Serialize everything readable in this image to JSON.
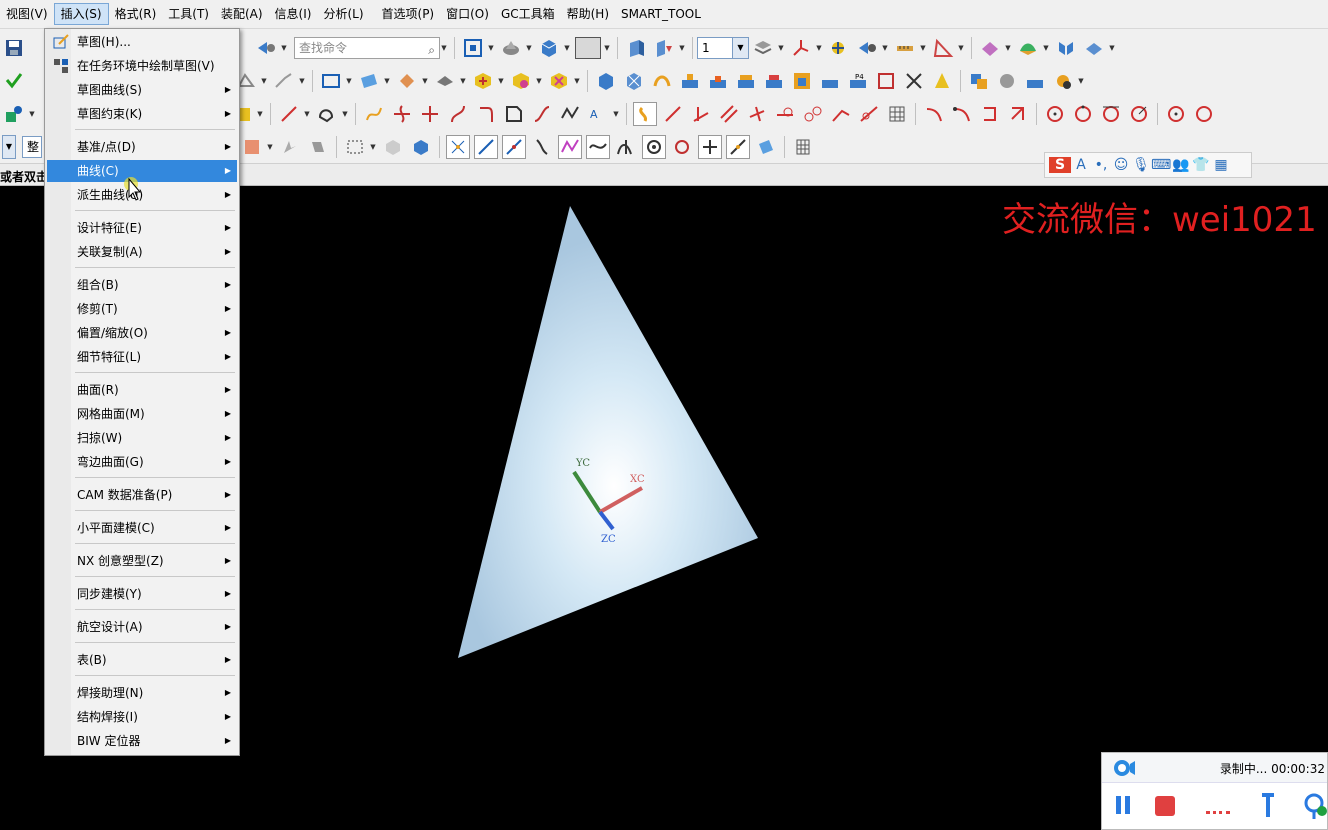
{
  "menubar": [
    "视图(V)",
    "插入(S)",
    "格式(R)",
    "工具(T)",
    "装配(A)",
    "信息(I)",
    "分析(L)",
    "首选项(P)",
    "窗口(O)",
    "GC工具箱",
    "帮助(H)",
    "SMART_TOOL"
  ],
  "toolbar": {
    "search_placeholder": "查找命令",
    "layer_value": "1",
    "filter_value": "整"
  },
  "status": {
    "prompt": "或者双击"
  },
  "menu": {
    "items": [
      {
        "label": "草图(H)...",
        "sub": false,
        "icon": "sketch-icon"
      },
      {
        "label": "在任务环境中绘制草图(V)",
        "sub": false,
        "icon": "sketch-task-icon"
      },
      {
        "label": "草图曲线(S)",
        "sub": true
      },
      {
        "label": "草图约束(K)",
        "sub": true
      },
      {
        "label": "基准/点(D)",
        "sub": true
      },
      {
        "label": "曲线(C)",
        "sub": true,
        "highlighted": true
      },
      {
        "label": "派生曲线(U)",
        "sub": true
      },
      {
        "label": "设计特征(E)",
        "sub": true
      },
      {
        "label": "关联复制(A)",
        "sub": true
      },
      {
        "label": "组合(B)",
        "sub": true
      },
      {
        "label": "修剪(T)",
        "sub": true
      },
      {
        "label": "偏置/缩放(O)",
        "sub": true
      },
      {
        "label": "细节特征(L)",
        "sub": true
      },
      {
        "label": "曲面(R)",
        "sub": true
      },
      {
        "label": "网格曲面(M)",
        "sub": true
      },
      {
        "label": "扫掠(W)",
        "sub": true
      },
      {
        "label": "弯边曲面(G)",
        "sub": true
      },
      {
        "label": "CAM 数据准备(P)",
        "sub": true
      },
      {
        "label": "小平面建模(C)",
        "sub": true
      },
      {
        "label": "NX 创意塑型(Z)",
        "sub": true
      },
      {
        "label": "同步建模(Y)",
        "sub": true
      },
      {
        "label": "航空设计(A)",
        "sub": true
      },
      {
        "label": "表(B)",
        "sub": true
      },
      {
        "label": "焊接助理(N)",
        "sub": true
      },
      {
        "label": "结构焊接(I)",
        "sub": true
      },
      {
        "label": "BIW 定位器",
        "sub": true
      }
    ]
  },
  "viewport": {
    "watermark": "交流微信：wei1021",
    "axes": {
      "x": "XC",
      "y": "YC",
      "z": "ZC"
    }
  },
  "recorder": {
    "status": "录制中... 00:00:32"
  },
  "colors": {
    "highlight": "#3388dd",
    "watermark": "#e02020",
    "surface": "#bcd8ec"
  }
}
